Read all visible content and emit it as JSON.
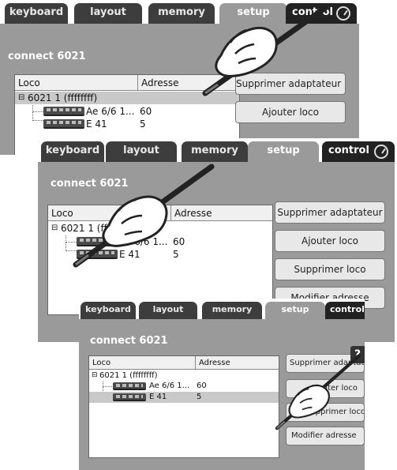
{
  "shots": [
    {
      "tabs": [
        "keyboard",
        "layout",
        "memory",
        "setup",
        "control"
      ],
      "title": "connect 6021",
      "columns": [
        "Loco",
        "Adresse"
      ],
      "root": "6021 1 (ffffffff)",
      "locos": [
        {
          "name": "Ae 6/6 1...",
          "address": "60"
        },
        {
          "name": "E 41",
          "address": "5"
        }
      ],
      "buttons": [
        "Supprimer adaptateur",
        "Ajouter loco"
      ]
    },
    {
      "tabs": [
        "keyboard",
        "layout",
        "memory",
        "setup",
        "control"
      ],
      "title": "connect 6021",
      "columns": [
        "Loco",
        "Adresse"
      ],
      "root": "6021 1 (ffffffff)",
      "locos": [
        {
          "name": "Ae 6/6 1...",
          "address": "60"
        },
        {
          "name": "E 41",
          "address": "5"
        }
      ],
      "buttons": [
        "Supprimer adaptateur",
        "Ajouter loco",
        "Supprimer loco",
        "Modifier adresse"
      ]
    },
    {
      "tabs": [
        "keyboard",
        "layout",
        "memory",
        "setup",
        "control"
      ],
      "title": "connect 6021",
      "columns": [
        "Loco",
        "Adresse"
      ],
      "root": "6021 1 (ffffffff)",
      "locos": [
        {
          "name": "Ae 6/6 1...",
          "address": "60"
        },
        {
          "name": "E 41",
          "address": "5"
        }
      ],
      "buttons": [
        "Supprimer adaptateur",
        "Ajouter loco",
        "Supprimer loco",
        "Modifier adresse"
      ],
      "help": "?"
    }
  ],
  "colors": {
    "panel": "#9a9a9a",
    "tab": "#3d3d3d",
    "selected_row": "#c9c9c9"
  }
}
